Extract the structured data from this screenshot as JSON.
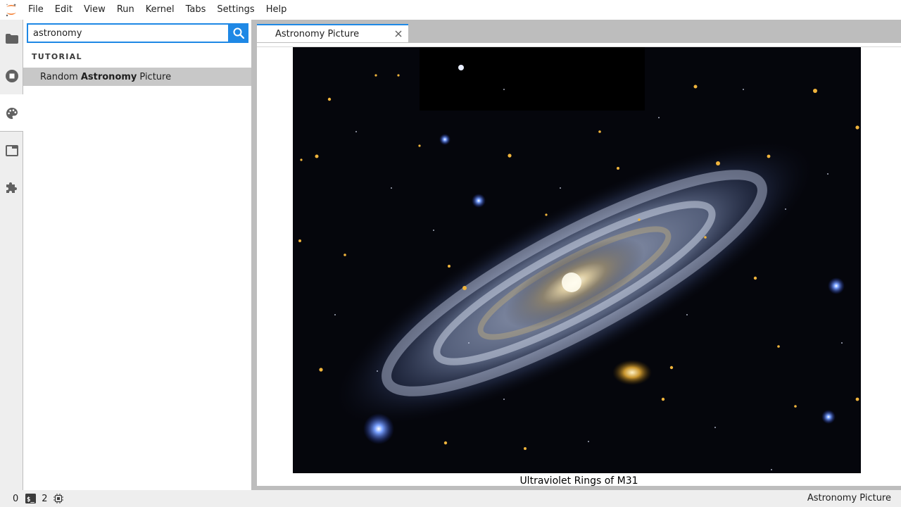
{
  "menubar": {
    "items": [
      "File",
      "Edit",
      "View",
      "Run",
      "Kernel",
      "Tabs",
      "Settings",
      "Help"
    ]
  },
  "activity_bar": {
    "icons": [
      "folder-icon",
      "running-sessions-icon",
      "palette-icon",
      "tabs-icon",
      "extension-puzzle-icon"
    ],
    "active": "palette-icon"
  },
  "command_palette": {
    "search_value": "astronomy",
    "section_heading": "TUTORIAL",
    "result": {
      "prefix": "Random",
      "match": "Astronomy",
      "suffix": "Picture"
    }
  },
  "tab": {
    "label": "Astronomy Picture"
  },
  "content": {
    "caption": "Ultraviolet Rings of M31"
  },
  "statusbar": {
    "kernels": "0",
    "terminals": "2",
    "right_label": "Astronomy Picture"
  },
  "colors": {
    "accent": "#1e88e5",
    "panel_bg": "#eeeeee",
    "selected_bg": "#c8c8c8"
  }
}
